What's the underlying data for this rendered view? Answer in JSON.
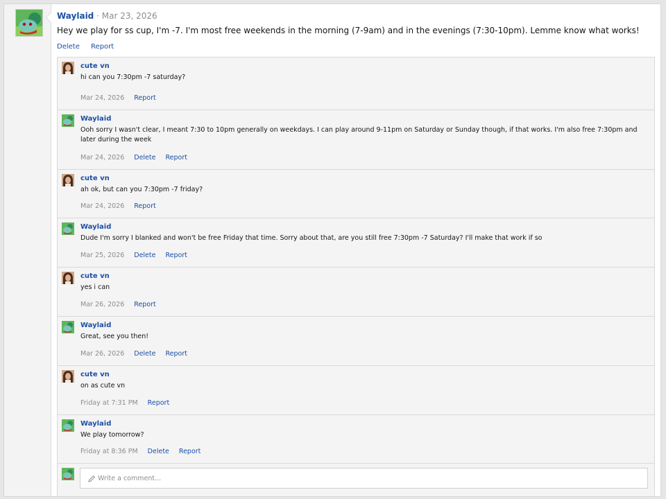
{
  "post": {
    "author": "Waylaid",
    "separator": "·",
    "date": "Mar 23, 2026",
    "text": "Hey we play for ss cup, I'm -7. I'm most free weekends in the morning (7-9am) and in the evenings (7:30-10pm). Lemme know what works!",
    "actions": {
      "delete": "Delete",
      "report": "Report"
    }
  },
  "comments": [
    {
      "author": "cute vn",
      "avatar": "girl-avatar",
      "text": "hi can you 7:30pm -7 saturday?",
      "date": "Mar 24, 2026",
      "actions": [
        "Report"
      ]
    },
    {
      "author": "Waylaid",
      "avatar": "bulbasaur-avatar",
      "text": "Ooh sorry I wasn't clear, I meant 7:30 to 10pm generally on weekdays. I can play around 9-11pm on Saturday or Sunday though, if that works. I'm also free 7:30pm and later during the week",
      "date": "Mar 24, 2026",
      "actions": [
        "Delete",
        "Report"
      ]
    },
    {
      "author": "cute vn",
      "avatar": "girl-avatar",
      "text": "ah ok, but can you 7:30pm -7 friday?",
      "date": "Mar 24, 2026",
      "actions": [
        "Report"
      ]
    },
    {
      "author": "Waylaid",
      "avatar": "bulbasaur-avatar",
      "text": "Dude I'm sorry I blanked and won't be free Friday that time. Sorry about that, are you still free 7:30pm -7 Saturday? I'll make that work if so",
      "date": "Mar 25, 2026",
      "actions": [
        "Delete",
        "Report"
      ]
    },
    {
      "author": "cute vn",
      "avatar": "girl-avatar",
      "text": "yes i can",
      "date": "Mar 26, 2026",
      "actions": [
        "Report"
      ]
    },
    {
      "author": "Waylaid",
      "avatar": "bulbasaur-avatar",
      "text": "Great, see you then!",
      "date": "Mar 26, 2026",
      "actions": [
        "Delete",
        "Report"
      ]
    },
    {
      "author": "cute vn",
      "avatar": "girl-avatar",
      "text": "on as cute vn",
      "date": "Friday at 7:31 PM",
      "actions": [
        "Report"
      ]
    },
    {
      "author": "Waylaid",
      "avatar": "bulbasaur-avatar",
      "text": "We play tomorrow?",
      "date": "Friday at 8:36 PM",
      "actions": [
        "Delete",
        "Report"
      ]
    }
  ],
  "comment_box": {
    "placeholder": "Write a comment...",
    "icon": "pencil-icon"
  },
  "colors": {
    "link": "#1b4fa6",
    "muted": "#8c8c8c",
    "panel": "#f4f4f4",
    "border": "#d9d9d9"
  }
}
